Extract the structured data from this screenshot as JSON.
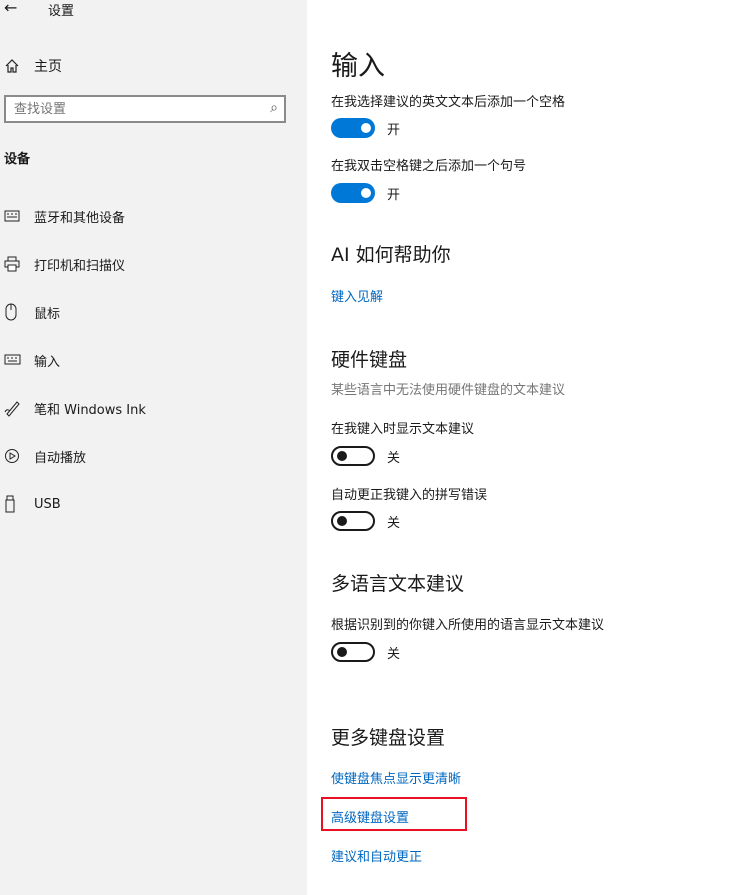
{
  "window": {
    "back_glyph": "←",
    "title": "设置"
  },
  "sidebar": {
    "home": {
      "icon": "home-icon",
      "label": "主页"
    },
    "search": {
      "placeholder": "查找设置",
      "icon": "search-icon"
    },
    "section_title": "设备",
    "items": [
      {
        "icon": "keyboard-bluetooth-icon",
        "label": "蓝牙和其他设备"
      },
      {
        "icon": "printer-icon",
        "label": "打印机和扫描仪"
      },
      {
        "icon": "mouse-icon",
        "label": "鼠标"
      },
      {
        "icon": "keyboard-icon",
        "label": "输入"
      },
      {
        "icon": "pen-icon",
        "label": "笔和 Windows Ink"
      },
      {
        "icon": "autoplay-icon",
        "label": "自动播放"
      },
      {
        "icon": "usb-icon",
        "label": "USB"
      }
    ]
  },
  "main": {
    "title": "输入",
    "toggles_top": [
      {
        "label": "在我选择建议的英文文本后添加一个空格",
        "state": "on",
        "state_label": "开"
      },
      {
        "label": "在我双击空格键之后添加一个句号",
        "state": "on",
        "state_label": "开"
      }
    ],
    "ai": {
      "heading": "AI 如何帮助你",
      "link": "键入见解"
    },
    "hardware": {
      "heading": "硬件键盘",
      "description": "某些语言中无法使用硬件键盘的文本建议",
      "toggles": [
        {
          "label": "在我键入时显示文本建议",
          "state": "off",
          "state_label": "关"
        },
        {
          "label": "自动更正我键入的拼写错误",
          "state": "off",
          "state_label": "关"
        }
      ]
    },
    "multilingual": {
      "heading": "多语言文本建议",
      "toggle": {
        "label": "根据识别到的你键入所使用的语言显示文本建议",
        "state": "off",
        "state_label": "关"
      }
    },
    "more": {
      "heading": "更多键盘设置",
      "links": [
        "使键盘焦点显示更清晰",
        "高级键盘设置",
        "建议和自动更正"
      ],
      "highlighted_link_index": 1,
      "highlight_color": "#e81123"
    }
  },
  "colors": {
    "accent": "#0078d7",
    "link": "#0067c0",
    "sidebar_bg": "#f2f2f2"
  }
}
